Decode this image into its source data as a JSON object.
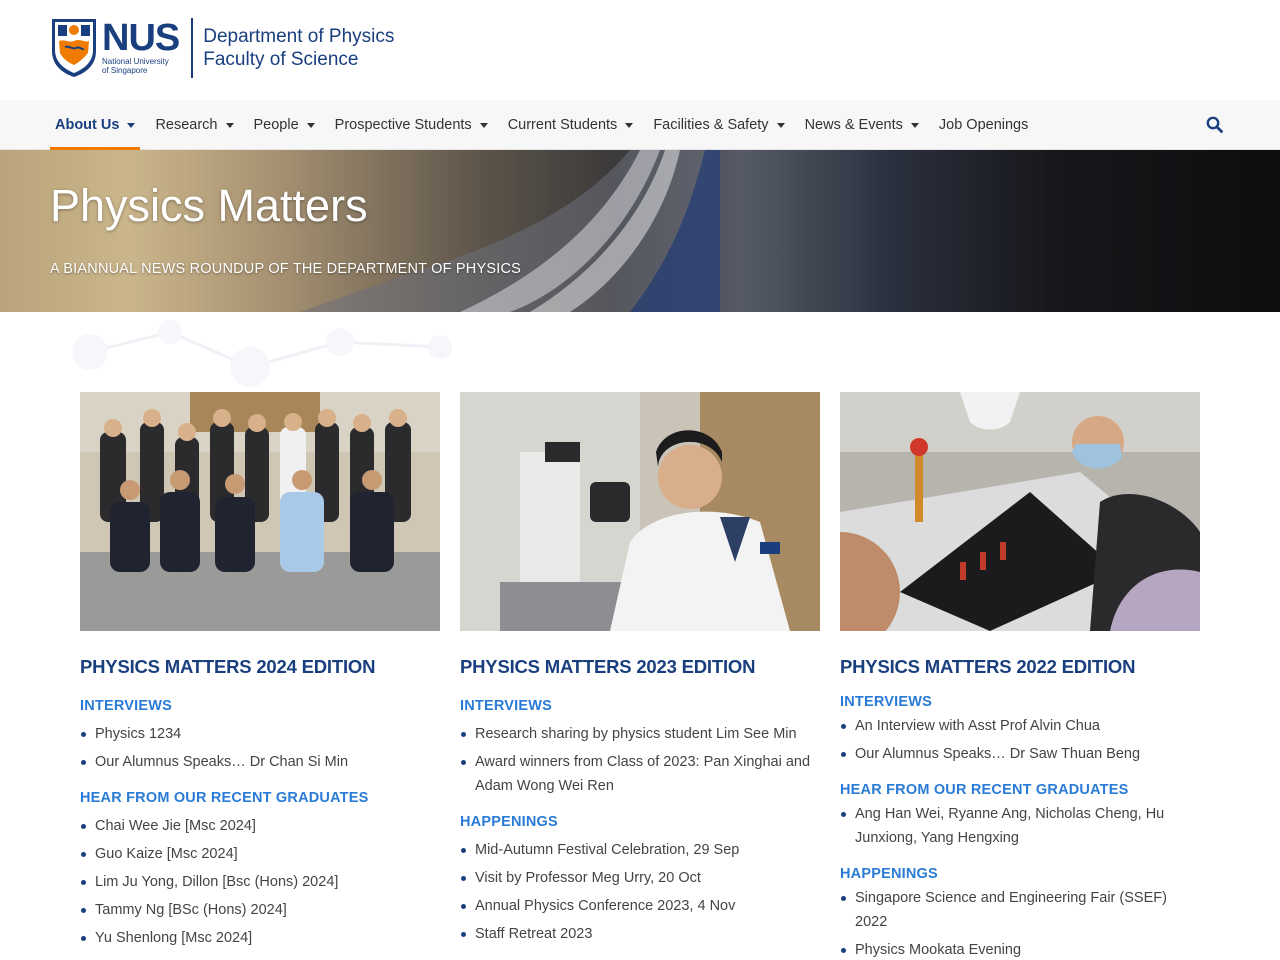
{
  "header": {
    "logo_word": "NUS",
    "logo_sub_1": "National University",
    "logo_sub_2": "of Singapore",
    "dept_line_1": "Department of Physics",
    "dept_line_2": "Faculty of Science"
  },
  "nav": {
    "items": [
      {
        "label": "About Us",
        "active": true,
        "dropdown": true
      },
      {
        "label": "Research",
        "dropdown": true
      },
      {
        "label": "People",
        "dropdown": true
      },
      {
        "label": "Prospective Students",
        "dropdown": true
      },
      {
        "label": "Current Students",
        "dropdown": true
      },
      {
        "label": "Facilities & Safety",
        "dropdown": true
      },
      {
        "label": "News & Events",
        "dropdown": true
      },
      {
        "label": "Job Openings",
        "dropdown": false
      }
    ],
    "search_icon": "search-icon"
  },
  "banner": {
    "title": "Physics Matters",
    "subtitle": "A BIANNUAL NEWS ROUNDUP OF THE DEPARTMENT OF PHYSICS"
  },
  "editions": [
    {
      "title": "PHYSICS MATTERS 2024 EDITION",
      "sections": [
        {
          "heading": "INTERVIEWS",
          "items": [
            "Physics 1234",
            "Our Alumnus Speaks… Dr Chan Si Min"
          ]
        },
        {
          "heading": "HEAR FROM OUR RECENT GRADUATES",
          "items": [
            "Chai Wee Jie [Msc 2024]",
            "Guo Kaize [Msc 2024]",
            "Lim Ju Yong, Dillon [Bsc (Hons) 2024]",
            "Tammy Ng [BSc (Hons) 2024]",
            "Yu Shenlong [Msc 2024]"
          ]
        }
      ]
    },
    {
      "title": "PHYSICS MATTERS 2023 EDITION",
      "sections": [
        {
          "heading": "INTERVIEWS",
          "items": [
            "Research sharing by physics student Lim See Min",
            "Award winners from Class of 2023: Pan Xinghai and Adam Wong Wei Ren"
          ]
        },
        {
          "heading": "HAPPENINGS",
          "items": [
            "Mid-Autumn Festival Celebration, 29 Sep",
            "Visit by Professor Meg Urry, 20 Oct",
            "Annual Physics Conference 2023, 4 Nov",
            "Staff Retreat 2023"
          ]
        }
      ]
    },
    {
      "title": "PHYSICS MATTERS 2022 EDITION",
      "sections": [
        {
          "heading": "INTERVIEWS",
          "items": [
            "An Interview with Asst Prof Alvin Chua",
            "Our Alumnus Speaks… Dr Saw Thuan Beng"
          ]
        },
        {
          "heading": "HEAR FROM OUR RECENT GRADUATES",
          "items": [
            "Ang Han Wei, Ryanne Ang, Nicholas Cheng, Hu Junxiong, Yang Hengxing"
          ]
        },
        {
          "heading": "HAPPENINGS",
          "items": [
            "Singapore Science and Engineering Fair (SSEF) 2022",
            "Physics Mookata Evening"
          ]
        }
      ]
    }
  ],
  "colors": {
    "brand_blue": "#1a3f7f",
    "accent_orange": "#ef7c00",
    "link_blue": "#2a7bd6"
  }
}
